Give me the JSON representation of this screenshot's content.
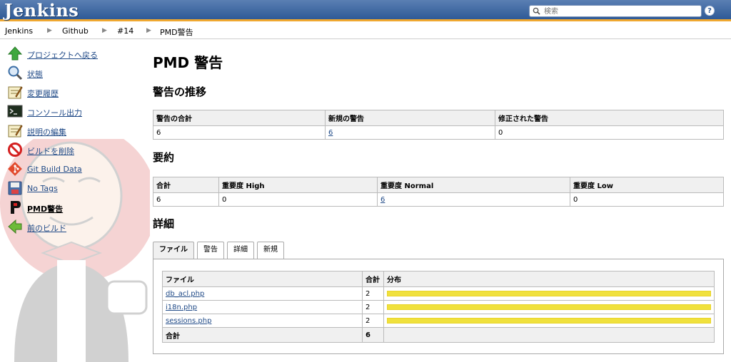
{
  "header": {
    "logo": "Jenkins",
    "search_placeholder": "検索",
    "help_label": "?"
  },
  "breadcrumb": [
    "Jenkins",
    "Github",
    "#14",
    "PMD警告"
  ],
  "sidebar": {
    "items": [
      {
        "label": "プロジェクトへ戻る",
        "icon": "up-arrow-icon"
      },
      {
        "label": "状態",
        "icon": "magnifier-icon"
      },
      {
        "label": "変更履歴",
        "icon": "notepad-icon"
      },
      {
        "label": "コンソール出力",
        "icon": "terminal-icon"
      },
      {
        "label": "説明の編集",
        "icon": "notepad-icon"
      },
      {
        "label": "ビルドを削除",
        "icon": "no-entry-icon"
      },
      {
        "label": "Git Build Data",
        "icon": "git-icon"
      },
      {
        "label": "No Tags",
        "icon": "save-icon"
      },
      {
        "label": "PMD警告",
        "icon": "pmd-icon"
      },
      {
        "label": "前のビルド",
        "icon": "left-arrow-icon"
      }
    ]
  },
  "main": {
    "title": "PMD 警告",
    "trend_heading": "警告の推移",
    "trend_table": {
      "headers": [
        "警告の合計",
        "新規の警告",
        "修正された警告"
      ],
      "values": [
        "6",
        "6",
        "0"
      ]
    },
    "summary_heading": "要約",
    "summary_table": {
      "headers": [
        "合計",
        "重要度 High",
        "重要度 Normal",
        "重要度 Low"
      ],
      "values": [
        "6",
        "0",
        "6",
        "0"
      ]
    },
    "details_heading": "詳細",
    "tabs": [
      "ファイル",
      "警告",
      "詳細",
      "新規"
    ],
    "files_table": {
      "headers": [
        "ファイル",
        "合計",
        "分布"
      ],
      "rows": [
        {
          "file": "db_acl.php",
          "count": "2",
          "distribution": 1.0
        },
        {
          "file": "i18n.php",
          "count": "2",
          "distribution": 1.0
        },
        {
          "file": "sessions.php",
          "count": "2",
          "distribution": 1.0
        }
      ],
      "total_label": "合計",
      "total_value": "6"
    }
  },
  "colors": {
    "header_blue": "#2f5a96",
    "header_accent": "#f0a830",
    "link": "#204a87",
    "bar": "#f0e13d"
  }
}
